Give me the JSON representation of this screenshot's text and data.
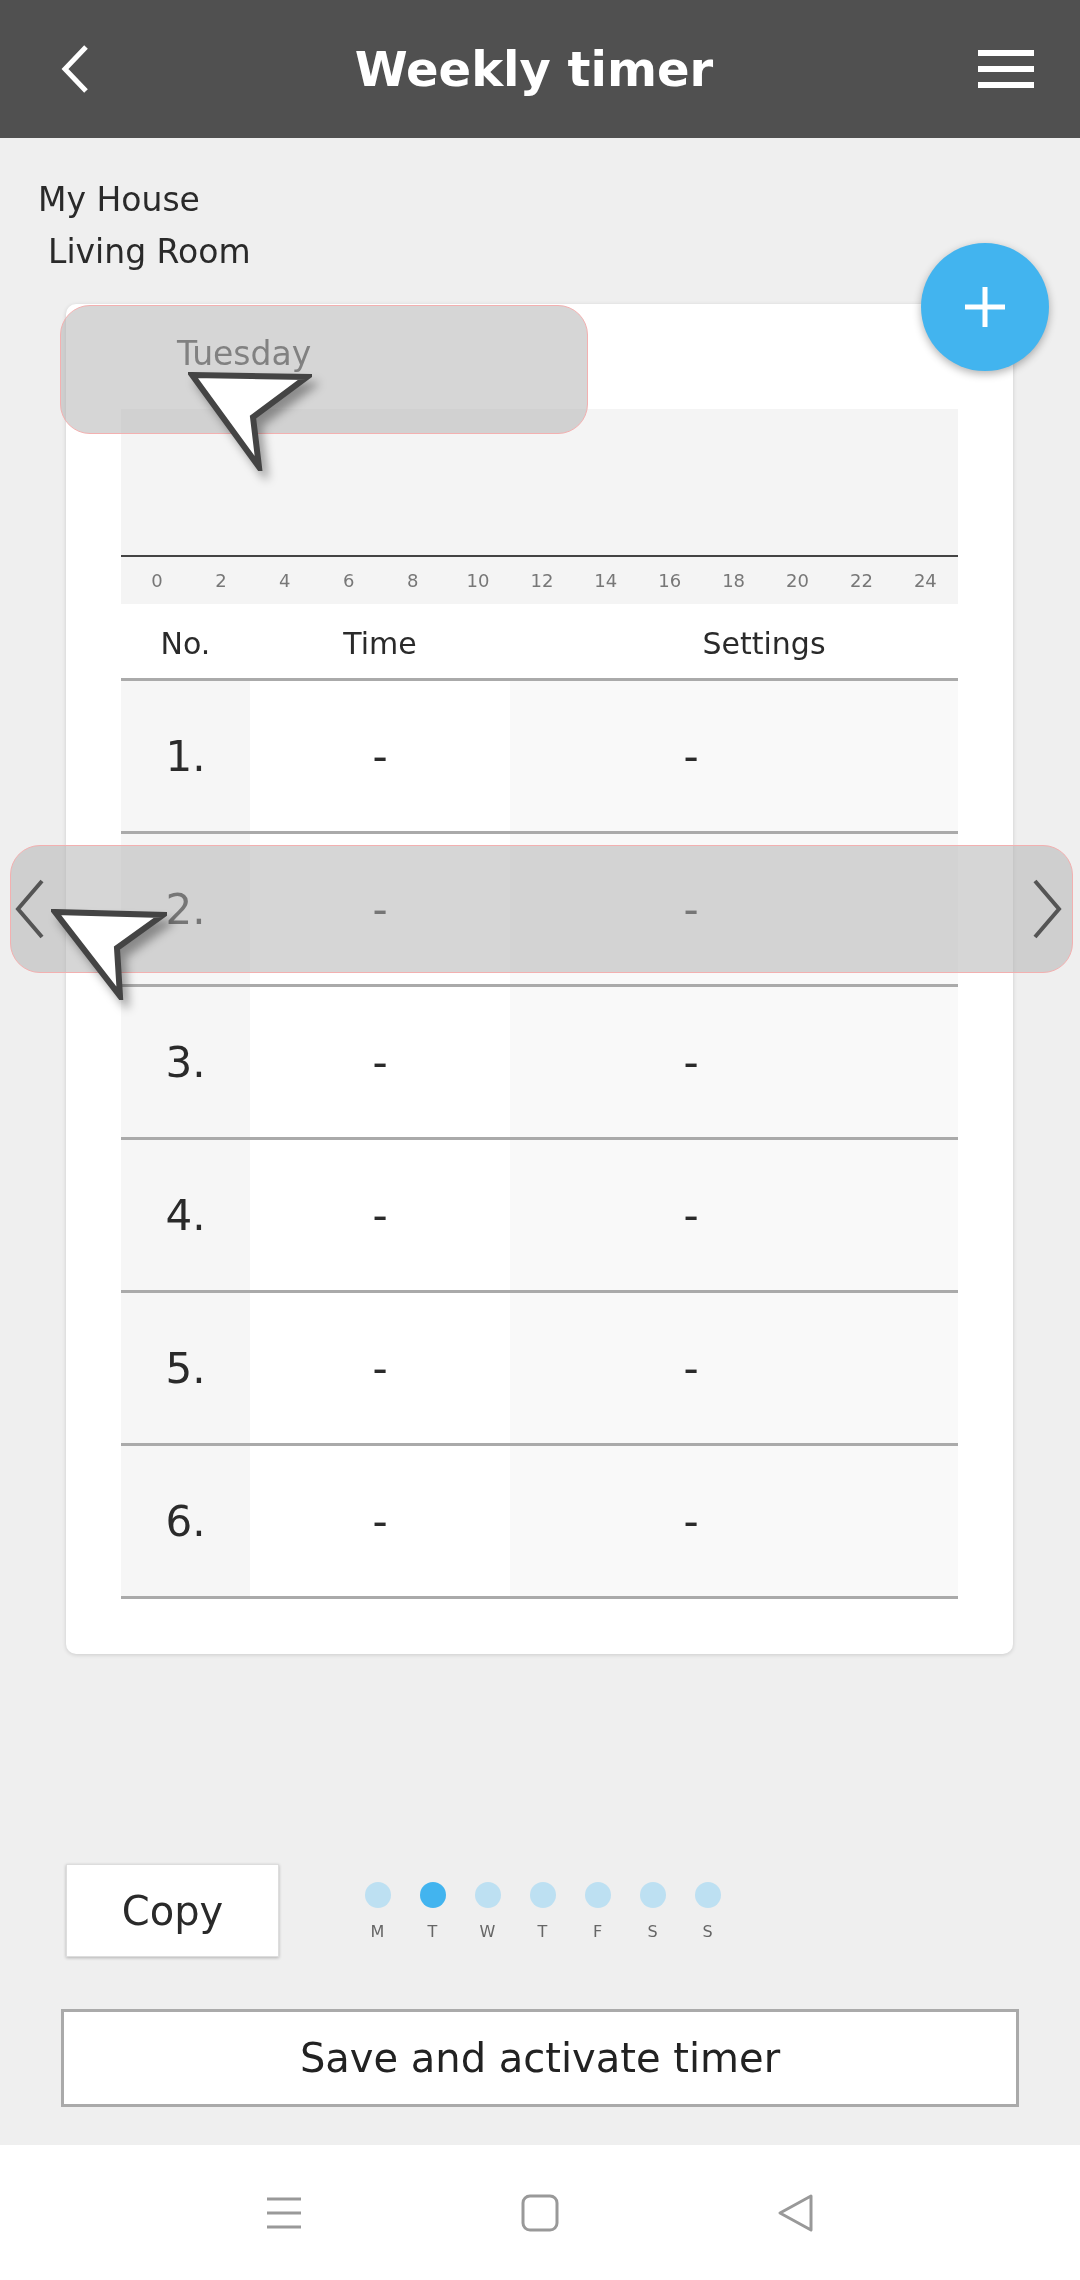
{
  "header": {
    "title": "Weekly timer"
  },
  "location": {
    "home": "My House",
    "room": "Living Room"
  },
  "day_card": {
    "day": "Tuesday",
    "timeline": {
      "ticks": [
        "0",
        "2",
        "4",
        "6",
        "8",
        "10",
        "12",
        "14",
        "16",
        "18",
        "20",
        "22",
        "24"
      ]
    },
    "table": {
      "columns": [
        "No.",
        "Time",
        "Settings"
      ],
      "rows": [
        {
          "no": "1.",
          "time": "-",
          "settings": "-"
        },
        {
          "no": "2.",
          "time": "-",
          "settings": "-"
        },
        {
          "no": "3.",
          "time": "-",
          "settings": "-"
        },
        {
          "no": "4.",
          "time": "-",
          "settings": "-"
        },
        {
          "no": "5.",
          "time": "-",
          "settings": "-"
        },
        {
          "no": "6.",
          "time": "-",
          "settings": "-"
        }
      ]
    }
  },
  "copy_button": "Copy",
  "days": [
    {
      "label": "M",
      "selected": false
    },
    {
      "label": "T",
      "selected": true
    },
    {
      "label": "W",
      "selected": false
    },
    {
      "label": "T",
      "selected": false
    },
    {
      "label": "F",
      "selected": false
    },
    {
      "label": "S",
      "selected": false
    },
    {
      "label": "S",
      "selected": false
    }
  ],
  "save_button": "Save and activate timer"
}
